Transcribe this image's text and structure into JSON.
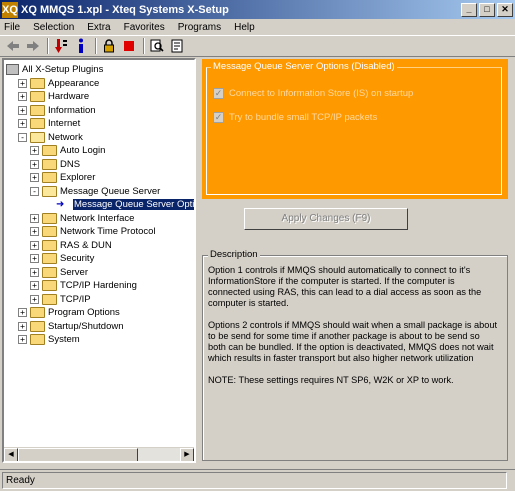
{
  "window": {
    "title": "XQ MMQS 1.xpl - Xteq Systems X-Setup",
    "app_icon": "XQ",
    "min_glyph": "_",
    "max_glyph": "□",
    "close_glyph": "✕"
  },
  "menu": [
    "File",
    "Selection",
    "Extra",
    "Favorites",
    "Programs",
    "Help"
  ],
  "toolbar": {
    "icons": [
      "back-arrow-icon",
      "forward-arrow-icon",
      "apply-arrow-icon",
      "info-icon",
      "lock-icon",
      "stop-icon",
      "search-icon",
      "report-icon"
    ]
  },
  "tree": {
    "items": [
      {
        "label": "All X-Setup Plugins",
        "level": 0,
        "expander": "",
        "icon": "root"
      },
      {
        "label": "Appearance",
        "level": 1,
        "expander": "+",
        "icon": "folder"
      },
      {
        "label": "Hardware",
        "level": 1,
        "expander": "+",
        "icon": "folder"
      },
      {
        "label": "Information",
        "level": 1,
        "expander": "+",
        "icon": "folder"
      },
      {
        "label": "Internet",
        "level": 1,
        "expander": "+",
        "icon": "folder"
      },
      {
        "label": "Network",
        "level": 1,
        "expander": "-",
        "icon": "folder-open"
      },
      {
        "label": "Auto Login",
        "level": 2,
        "expander": "+",
        "icon": "folder"
      },
      {
        "label": "DNS",
        "level": 2,
        "expander": "+",
        "icon": "folder"
      },
      {
        "label": "Explorer",
        "level": 2,
        "expander": "+",
        "icon": "folder"
      },
      {
        "label": "Message Queue Server",
        "level": 2,
        "expander": "-",
        "icon": "folder-open"
      },
      {
        "label": "Message Queue Server Optio",
        "level": 3,
        "expander": "",
        "icon": "leaf",
        "selected": true
      },
      {
        "label": "Network Interface",
        "level": 2,
        "expander": "+",
        "icon": "folder"
      },
      {
        "label": "Network Time Protocol",
        "level": 2,
        "expander": "+",
        "icon": "folder"
      },
      {
        "label": "RAS & DUN",
        "level": 2,
        "expander": "+",
        "icon": "folder"
      },
      {
        "label": "Security",
        "level": 2,
        "expander": "+",
        "icon": "folder"
      },
      {
        "label": "Server",
        "level": 2,
        "expander": "+",
        "icon": "folder"
      },
      {
        "label": "TCP/IP Hardening",
        "level": 2,
        "expander": "+",
        "icon": "folder"
      },
      {
        "label": "TCP/IP",
        "level": 2,
        "expander": "+",
        "icon": "folder"
      },
      {
        "label": "Program Options",
        "level": 1,
        "expander": "+",
        "icon": "folder"
      },
      {
        "label": "Startup/Shutdown",
        "level": 1,
        "expander": "+",
        "icon": "folder"
      },
      {
        "label": "System",
        "level": 1,
        "expander": "+",
        "icon": "folder"
      }
    ]
  },
  "options": {
    "group_title": "Message Queue Server Options (Disabled)",
    "checkboxes": [
      {
        "label": "Connect to Information Store (IS) on startup",
        "checked": true
      },
      {
        "label": "Try to bundle small TCP/IP packets",
        "checked": true
      }
    ],
    "panel_color": "#ff9900"
  },
  "apply_button": "Apply Changes (F9)",
  "description": {
    "title": "Description",
    "paragraphs": [
      "Option 1 controls if MMQS should automatically to connect to it's\nInformationStore if the computer is started. If the computer is\nconnected using RAS, this can lead to a dial access as soon as the\ncomputer is started.",
      "Options 2 controls if MMQS should wait when a small package is about\nto be send for some time if another package is about to be send so\nboth can be bundled. If the option is deactivated, MMQS does not wait\nwhich results in faster transport but also higher network utilization",
      "NOTE: These settings requires NT SP6, W2K or XP to work."
    ]
  },
  "status": "Ready"
}
